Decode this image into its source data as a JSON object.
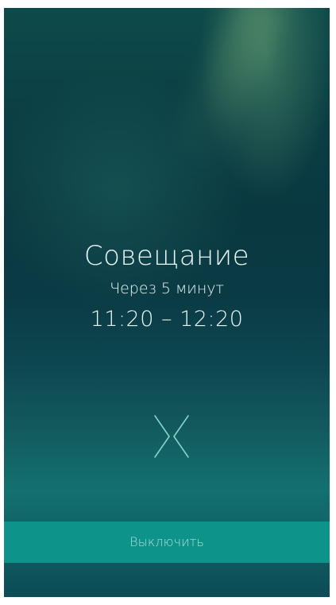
{
  "alarm": {
    "title": "Совещание",
    "subtitle": "Через 5 минут",
    "time_range": "11:20 – 12:20"
  },
  "controls": {
    "dismiss_icon": "chevron-pair-icon",
    "dismiss_label": "Выключить"
  },
  "colors": {
    "accent": "#0e938a",
    "text": "#eaf6f5",
    "background_top": "#0e4a4a",
    "background_bottom": "#0c4b55"
  }
}
